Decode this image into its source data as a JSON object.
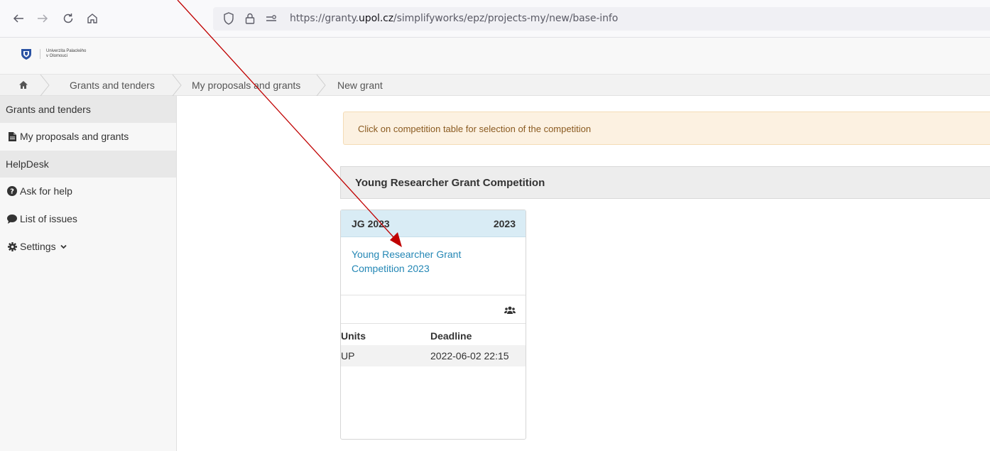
{
  "browser": {
    "url_prefix": "https://granty.",
    "url_domain": "upol.cz",
    "url_path": "/simplifyworks/epz/projects-my/new/base-info"
  },
  "header": {
    "logo_line1": "Univerzita Palackého",
    "logo_line2": "v Olomouci"
  },
  "breadcrumb": {
    "items": [
      "Grants and tenders",
      "My proposals and grants",
      "New grant"
    ]
  },
  "sidebar": {
    "section1": "Grants and tenders",
    "item_proposals": "My proposals and grants",
    "section2": "HelpDesk",
    "item_help": "Ask for help",
    "item_issues": "List of issues",
    "item_settings": "Settings"
  },
  "main": {
    "alert": "Click on competition table for selection of the competition",
    "competition_title": "Young Researcher Grant Competition",
    "card": {
      "code": "JG 2023",
      "year": "2023",
      "link": "Young Researcher Grant Competition 2023",
      "table_headers": [
        "Units",
        "Deadline"
      ],
      "rows": [
        [
          "UP",
          "2022-06-02 22:15"
        ]
      ]
    }
  },
  "colors": {
    "accent_link": "#2487b5",
    "alert_bg": "#fcf1e1",
    "card_head_bg": "#d9ecf5",
    "annotation_arrow": "#c00000"
  }
}
